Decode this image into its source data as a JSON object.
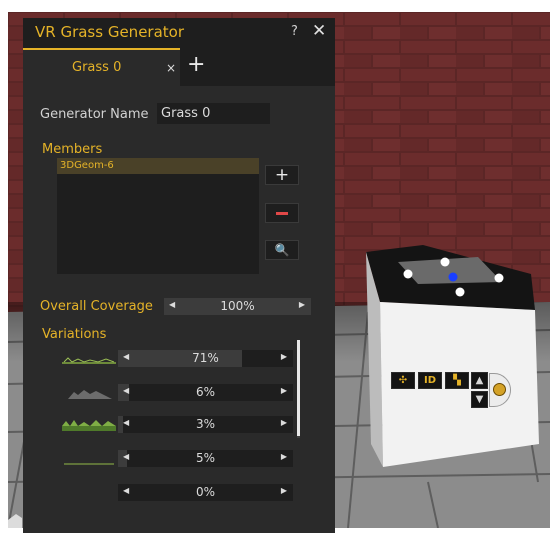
{
  "window": {
    "title": "VR Grass Generator",
    "help_label": "?",
    "close_label": "✕"
  },
  "tabs": [
    {
      "label": "Grass 0",
      "close_label": "×",
      "active": true
    }
  ],
  "add_tab_label": "+",
  "generator_name": {
    "label": "Generator Name",
    "value": "Grass 0"
  },
  "members": {
    "label": "Members",
    "items": [
      "3DGeom-6"
    ],
    "add_label": "+",
    "remove_icon": "minus-icon",
    "search_icon": "search-icon",
    "search_glyph": "🔍"
  },
  "overall_coverage": {
    "label": "Overall Coverage",
    "value_text": "100%",
    "value": 100
  },
  "variations": {
    "label": "Variations",
    "items": [
      {
        "value_text": "71%",
        "value": 71
      },
      {
        "value_text": "6%",
        "value": 6
      },
      {
        "value_text": "3%",
        "value": 3
      },
      {
        "value_text": "5%",
        "value": 5
      },
      {
        "value_text": "0%",
        "value": 0
      }
    ]
  },
  "slider_arrows": {
    "left": "◀",
    "right": "▶"
  },
  "gizmo": {
    "buttons": [
      {
        "icon": "move-icon",
        "glyph": "✣"
      },
      {
        "icon": "rotate-icon",
        "glyph": "ID"
      },
      {
        "icon": "scale-icon",
        "glyph": "▚"
      },
      {
        "icon": "up-arrow-icon",
        "glyph": "▲"
      },
      {
        "icon": "down-arrow-icon",
        "glyph": "▼"
      }
    ]
  },
  "colors": {
    "accent": "#e5b328",
    "panel_bg": "#2a2a2a",
    "field_bg": "#1e1e1e",
    "remove_red": "#e04848",
    "selected_member_bg": "#4a4128"
  }
}
